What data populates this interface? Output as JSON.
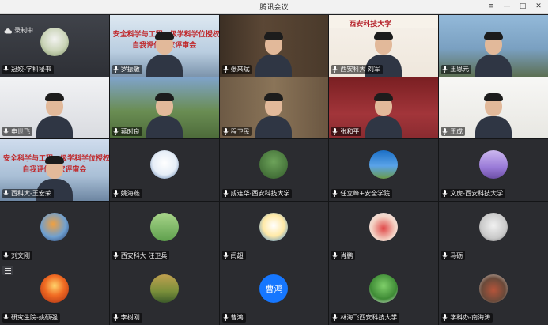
{
  "window": {
    "title": "腾讯会议",
    "buttons": {
      "menu": "≡",
      "minimize": "—",
      "maximize": "□",
      "close": "✕"
    }
  },
  "status": {
    "recording_label": "录制中"
  },
  "banner": {
    "line1": "安全科学与工程一级学科学位授权点",
    "line2": "自我评估专家评审会"
  },
  "logo": {
    "text": "西安科技大学"
  },
  "participants": [
    {
      "name": "冠姣-学科秘书",
      "kind": "video",
      "scene": "host"
    },
    {
      "name": "罗振敏",
      "kind": "video",
      "scene": "banner"
    },
    {
      "name": "张来斌",
      "kind": "video",
      "scene": "office"
    },
    {
      "name": "西安科大 刘军",
      "kind": "video",
      "scene": "logo"
    },
    {
      "name": "王恩元",
      "kind": "video",
      "scene": "building"
    },
    {
      "name": "申世飞",
      "kind": "video",
      "scene": "room"
    },
    {
      "name": "蒋时良",
      "kind": "video",
      "scene": "trees"
    },
    {
      "name": "程卫民",
      "kind": "video",
      "scene": "bookshelf"
    },
    {
      "name": "张和平",
      "kind": "video",
      "scene": "redwall"
    },
    {
      "name": "王成",
      "kind": "video",
      "scene": "brightroom"
    },
    {
      "name": "西科大-王宏荣",
      "kind": "video",
      "scene": "banner2"
    },
    {
      "name": "姚海燕",
      "kind": "avatar",
      "art": "rabbit"
    },
    {
      "name": "成连华-西安科技大学",
      "kind": "avatar",
      "art": "forest"
    },
    {
      "name": "任立峰+安全学院",
      "kind": "avatar",
      "art": "sky"
    },
    {
      "name": "文虎-西安科技大学",
      "kind": "avatar",
      "art": "lavender"
    },
    {
      "name": "刘文刚",
      "kind": "avatar",
      "art": "earth"
    },
    {
      "name": "西安科大 汪卫兵",
      "kind": "avatar",
      "art": "field"
    },
    {
      "name": "闫超",
      "kind": "avatar",
      "art": "cartoon"
    },
    {
      "name": "肖鹏",
      "kind": "avatar",
      "art": "child"
    },
    {
      "name": "马砺",
      "kind": "avatar",
      "art": "horse"
    },
    {
      "name": "研究生院-姚硕强",
      "kind": "avatar",
      "art": "sunset"
    },
    {
      "name": "李树刚",
      "kind": "avatar",
      "art": "woods"
    },
    {
      "name": "曹鸿",
      "kind": "avatar-text",
      "initials": "曹鸿"
    },
    {
      "name": "林海飞西安科技大学",
      "kind": "avatar",
      "art": "tree"
    },
    {
      "name": "学科办-南海涛",
      "kind": "avatar",
      "art": "bike"
    }
  ],
  "colors": {
    "grid_bg": "#141517",
    "tile_bg": "#2b2c30",
    "accent_avatar": "#1677ff",
    "banner_red": "#c0282b"
  },
  "icons": {
    "mic": "mic-icon",
    "cloud": "cloud-record-icon",
    "more": "more-menu-icon"
  }
}
